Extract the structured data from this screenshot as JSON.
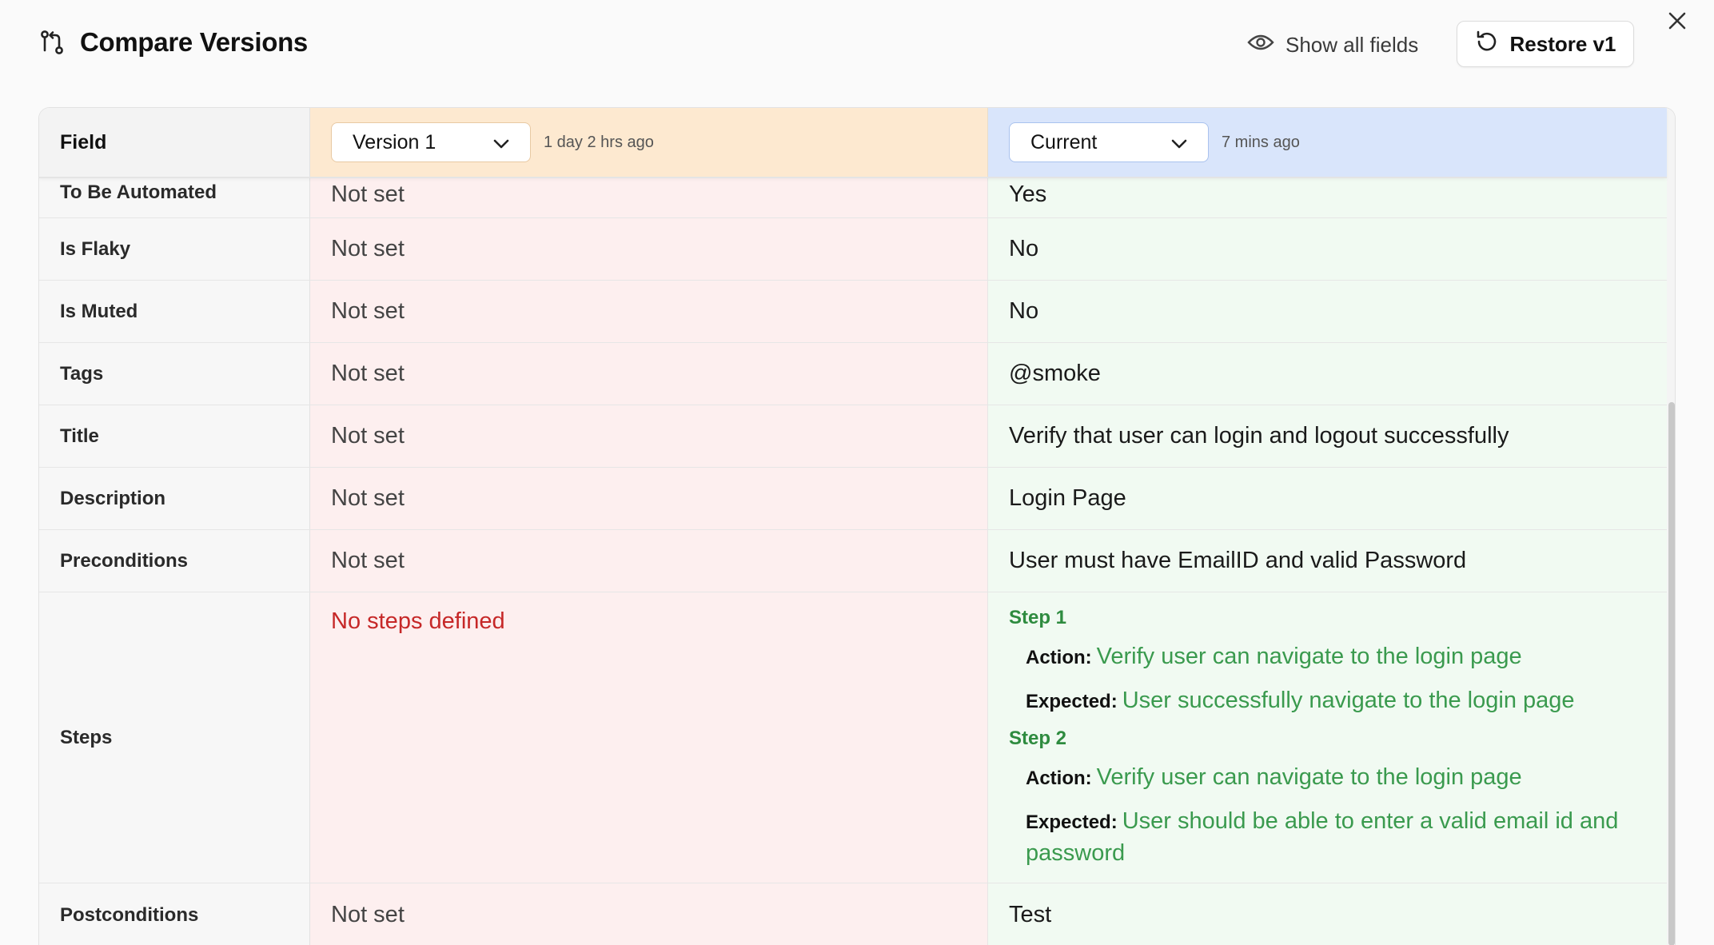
{
  "header": {
    "title": "Compare Versions",
    "show_all_label": "Show all fields",
    "restore_label": "Restore v1"
  },
  "table": {
    "field_header": "Field",
    "left": {
      "selected": "Version 1",
      "timestamp": "1 day 2 hrs ago"
    },
    "right": {
      "selected": "Current",
      "timestamp": "7 mins ago"
    },
    "rows": [
      {
        "field": "To Be Automated",
        "old": "Not set",
        "new": "Yes"
      },
      {
        "field": "Is Flaky",
        "old": "Not set",
        "new": "No"
      },
      {
        "field": "Is Muted",
        "old": "Not set",
        "new": "No"
      },
      {
        "field": "Tags",
        "old": "Not set",
        "new": "@smoke"
      },
      {
        "field": "Title",
        "old": "Not set",
        "new": "Verify that user can login and logout successfully"
      },
      {
        "field": "Description",
        "old": "Not set",
        "new": "Login Page"
      },
      {
        "field": "Preconditions",
        "old": "Not set",
        "new": "User must have EmailID and valid Password"
      }
    ],
    "steps_row": {
      "field": "Steps",
      "old": "No steps defined",
      "action_key": "Action:",
      "expected_key": "Expected:",
      "steps": [
        {
          "title": "Step 1",
          "action": "Verify user can navigate to the login page",
          "expected": "User successfully navigate to the login page"
        },
        {
          "title": "Step 2",
          "action": "Verify user can navigate to the login page",
          "expected": "User should be able to enter a valid email id and password"
        }
      ]
    },
    "post_row": {
      "field": "Postconditions",
      "old": "Not set",
      "new": "Test"
    }
  },
  "colors": {
    "old_bg": "#fdefef",
    "new_bg": "#f1faf2",
    "v1_header": "#fde9d0",
    "current_header": "#d9e5fb",
    "removed_text": "#c62828",
    "added_text": "#3a9a4e"
  }
}
